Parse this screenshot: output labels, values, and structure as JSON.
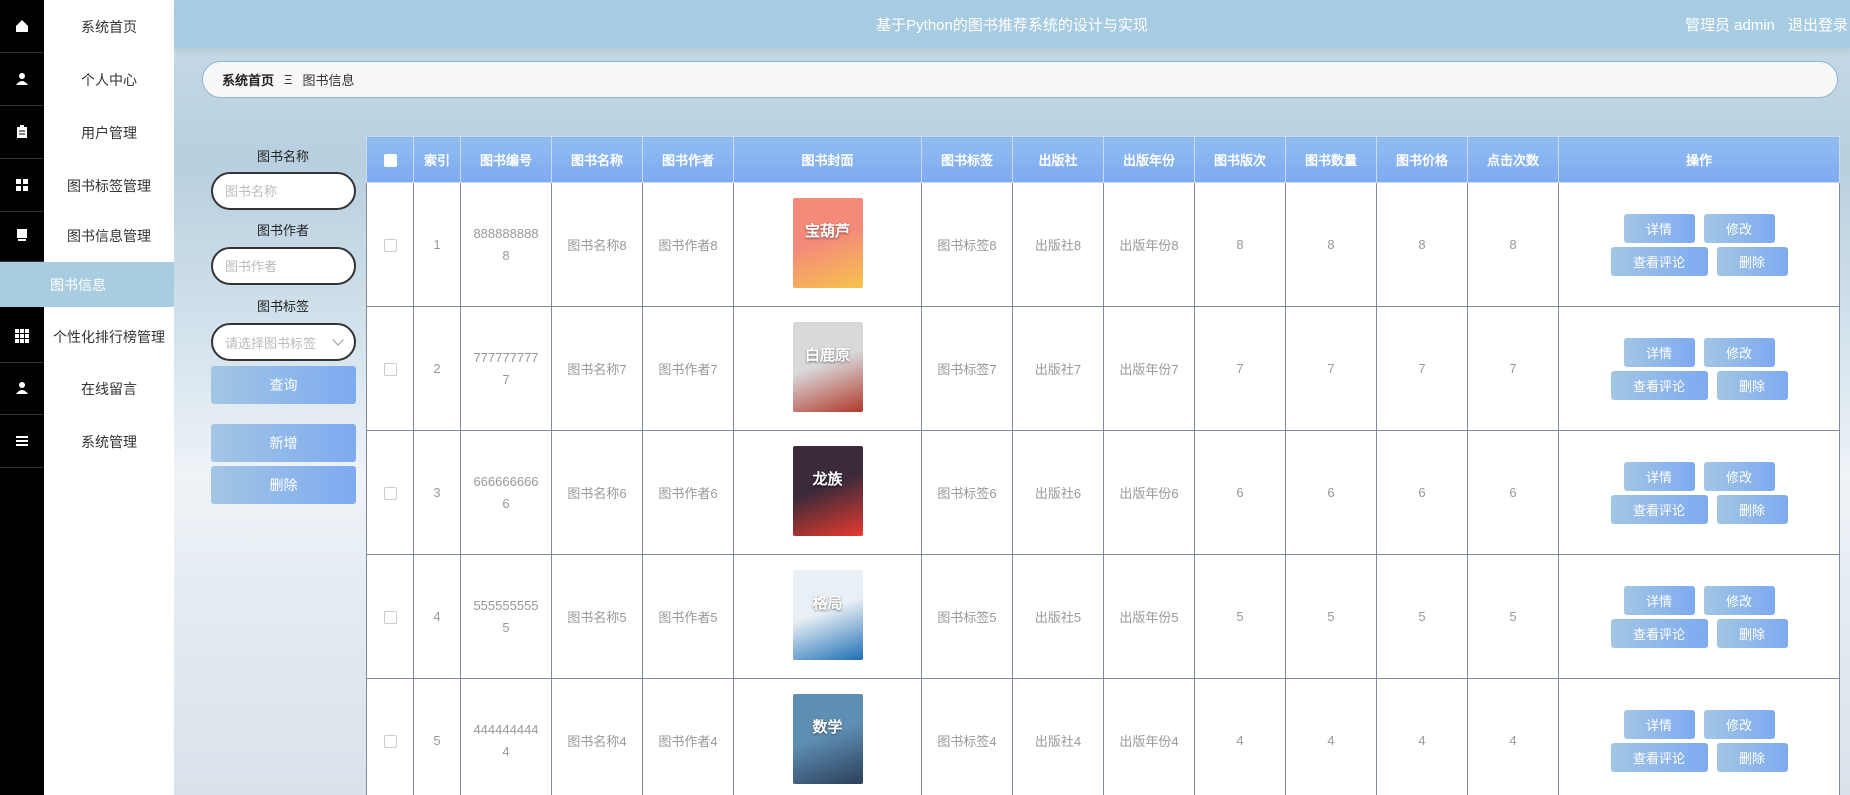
{
  "header": {
    "title": "基于Python的图书推荐系统的设计与实现",
    "admin_label": "管理员 admin",
    "logout": "退出登录"
  },
  "sidebar": {
    "items": [
      {
        "label": "系统首页",
        "icon": "home-icon"
      },
      {
        "label": "个人中心",
        "icon": "user-icon"
      },
      {
        "label": "用户管理",
        "icon": "clipboard-icon"
      },
      {
        "label": "图书标签管理",
        "icon": "grid-icon"
      },
      {
        "label": "图书信息管理",
        "icon": "monitor-icon"
      },
      {
        "label": "个性化排行榜管理",
        "icon": "apps-icon"
      },
      {
        "label": "在线留言",
        "icon": "user-icon"
      },
      {
        "label": "系统管理",
        "icon": "menu-icon"
      }
    ],
    "sub_item": "图书信息"
  },
  "breadcrumb": {
    "home": "系统首页",
    "separator": "Ξ",
    "current": "图书信息"
  },
  "search": {
    "name_label": "图书名称",
    "name_placeholder": "图书名称",
    "author_label": "图书作者",
    "author_placeholder": "图书作者",
    "tag_label": "图书标签",
    "tag_placeholder": "请选择图书标签",
    "query_button": "查询",
    "add_button": "新增",
    "delete_button": "删除"
  },
  "table": {
    "columns": [
      "索引",
      "图书编号",
      "图书名称",
      "图书作者",
      "图书封面",
      "图书标签",
      "出版社",
      "出版年份",
      "图书版次",
      "图书数量",
      "图书价格",
      "点击次数",
      "操作"
    ],
    "actions": {
      "detail": "详情",
      "edit": "修改",
      "comments": "查看评论",
      "delete": "删除"
    },
    "rows": [
      {
        "index": "1",
        "code": "8888888888",
        "name": "图书名称8",
        "author": "图书作者8",
        "tag": "图书标签8",
        "publisher": "出版社8",
        "year": "出版年份8",
        "edition": "8",
        "count": "8",
        "price": "8",
        "clicks": "8",
        "cover_colors": [
          "#f48a7a",
          "#f7c24d"
        ],
        "cover_text": "宝葫芦"
      },
      {
        "index": "2",
        "code": "7777777777",
        "name": "图书名称7",
        "author": "图书作者7",
        "tag": "图书标签7",
        "publisher": "出版社7",
        "year": "出版年份7",
        "edition": "7",
        "count": "7",
        "price": "7",
        "clicks": "7",
        "cover_colors": [
          "#d9d9dc",
          "#b13a2a"
        ],
        "cover_text": "白鹿原"
      },
      {
        "index": "3",
        "code": "6666666666",
        "name": "图书名称6",
        "author": "图书作者6",
        "tag": "图书标签6",
        "publisher": "出版社6",
        "year": "出版年份6",
        "edition": "6",
        "count": "6",
        "price": "6",
        "clicks": "6",
        "cover_colors": [
          "#3b2a3a",
          "#e63a2e"
        ],
        "cover_text": "龙族"
      },
      {
        "index": "4",
        "code": "5555555555",
        "name": "图书名称5",
        "author": "图书作者5",
        "tag": "图书标签5",
        "publisher": "出版社5",
        "year": "出版年份5",
        "edition": "5",
        "count": "5",
        "price": "5",
        "clicks": "5",
        "cover_colors": [
          "#e9f0f5",
          "#1f6fb5"
        ],
        "cover_text": "格局"
      },
      {
        "index": "5",
        "code": "4444444444",
        "name": "图书名称4",
        "author": "图书作者4",
        "tag": "图书标签4",
        "publisher": "出版社4",
        "year": "出版年份4",
        "edition": "4",
        "count": "4",
        "price": "4",
        "clicks": "4",
        "cover_colors": [
          "#5e8fb3",
          "#2b3f5a"
        ],
        "cover_text": "数学"
      }
    ]
  }
}
